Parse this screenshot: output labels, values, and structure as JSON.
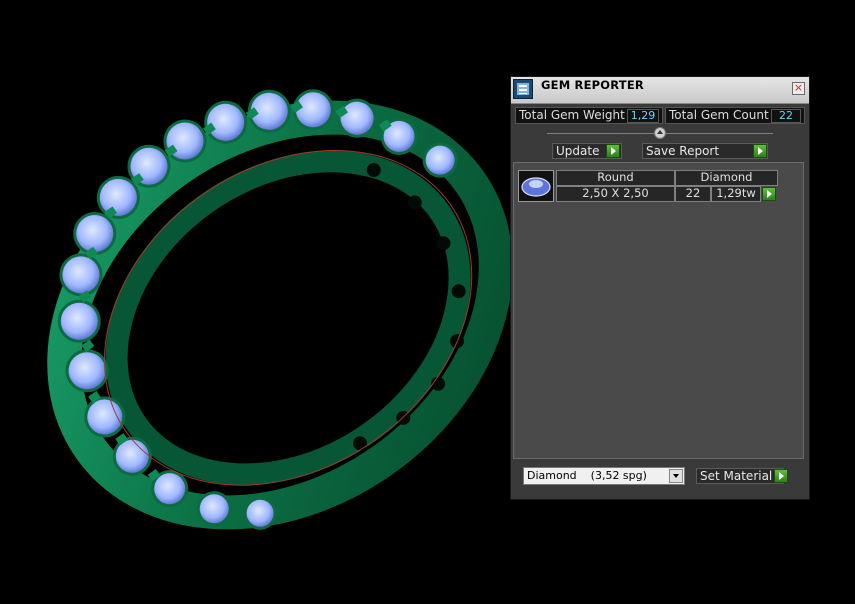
{
  "panel": {
    "title": "GEM REPORTER",
    "close_glyph": "×",
    "total_gem_weight_label": "Total Gem Weight",
    "total_gem_weight_value": "1,29",
    "total_gem_count_label": "Total Gem Count",
    "total_gem_count_value": "22",
    "update_label": "Update",
    "save_report_label": "Save Report",
    "gem_row": {
      "shape": "Round",
      "size": "2,50 X 2,50",
      "material": "Diamond",
      "count": "22",
      "weight": "1,29tw"
    },
    "material_select": {
      "selected": "Diamond    (3,52 spg)"
    },
    "set_material_label": "Set Material"
  },
  "colors": {
    "panel_bg": "#3a3a3a",
    "ring_green": "#0f7a4c",
    "gem_blue": "#a8c6ff",
    "accent_value": "#5fd5ff",
    "arrow_green": "#45a028"
  },
  "icons": {
    "app": "gem-reporter-app-icon",
    "close": "close-icon",
    "collapse": "collapse-arrow-icon",
    "go": "green-arrow-icon",
    "dropdown": "chevron-down-icon"
  }
}
